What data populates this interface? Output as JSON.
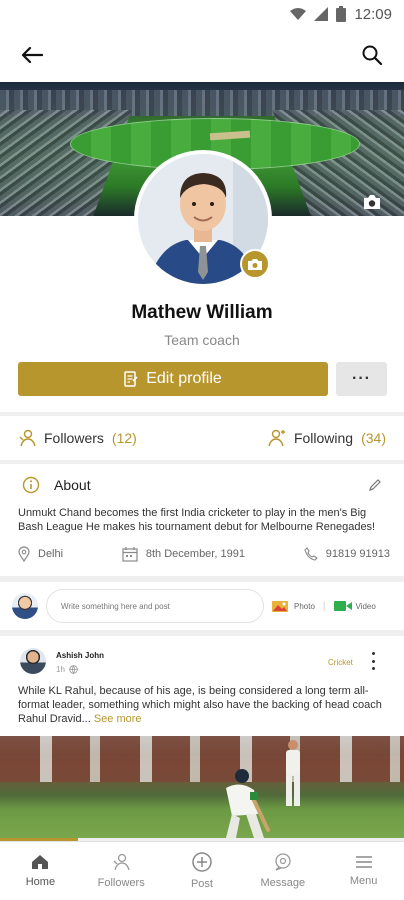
{
  "status_bar": {
    "time": "12:09"
  },
  "app_bar": {
    "back_icon": "back-arrow-icon",
    "search_icon": "search-icon"
  },
  "profile": {
    "name": "Mathew William",
    "role": "Team coach",
    "edit_label": "Edit profile",
    "more_label": "···"
  },
  "follow": {
    "followers_label": "Followers",
    "followers_count": "(12)",
    "following_label": "Following",
    "following_count": "(34)"
  },
  "about": {
    "title": "About",
    "text": "Unmukt Chand becomes the first India cricketer to play in the men's Big Bash League He makes his tournament debut for Melbourne Renegades!",
    "location": "Delhi",
    "dob": "8th December, 1991",
    "phone": "91819 91913"
  },
  "composer": {
    "placeholder": "Write something here and post",
    "photo_label": "Photo",
    "video_label": "Video",
    "separator": "|"
  },
  "post": {
    "author": "Ashish John",
    "time": "1h",
    "tag": "Cricket",
    "text": "While KL Rahul, because of his age, is being considered a long term all-format leader, something which might also have the backing of head coach Rahul Dravid...",
    "see_more": "See more"
  },
  "bottom_nav": [
    {
      "label": "Home",
      "icon": "home-icon"
    },
    {
      "label": "Followers",
      "icon": "followers-icon"
    },
    {
      "label": "Post",
      "icon": "add-post-icon"
    },
    {
      "label": "Message",
      "icon": "message-icon"
    },
    {
      "label": "Menu",
      "icon": "menu-icon"
    }
  ],
  "colors": {
    "accent": "#b8962e",
    "background": "#efefef"
  }
}
